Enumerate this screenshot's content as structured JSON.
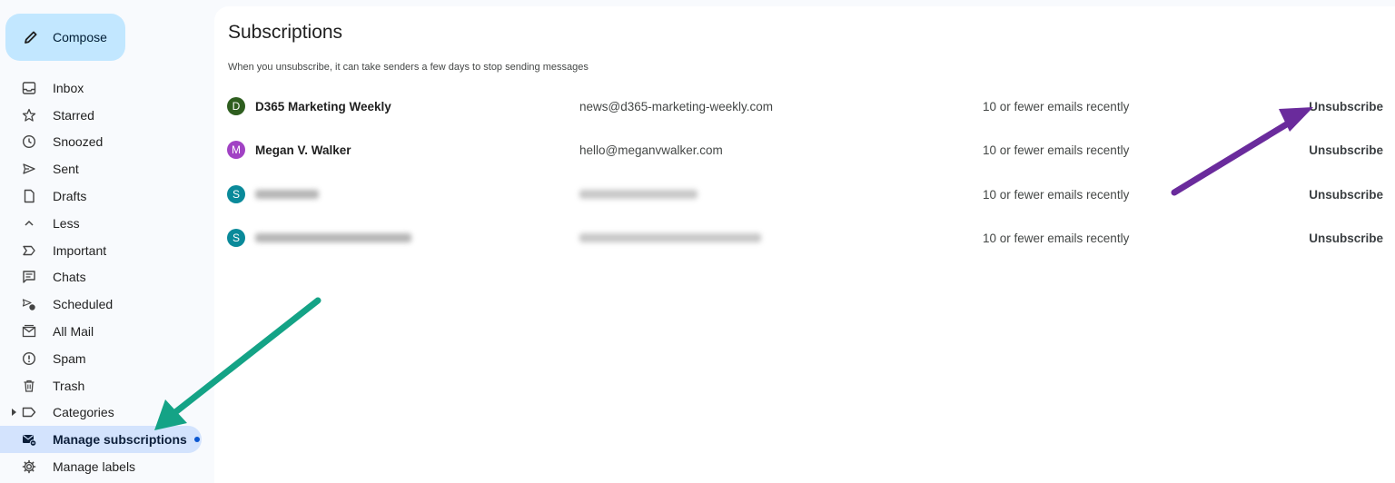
{
  "sidebar": {
    "compose_label": "Compose",
    "items": [
      {
        "label": "Inbox",
        "icon": "inbox-icon"
      },
      {
        "label": "Starred",
        "icon": "star-icon"
      },
      {
        "label": "Snoozed",
        "icon": "clock-icon"
      },
      {
        "label": "Sent",
        "icon": "send-icon"
      },
      {
        "label": "Drafts",
        "icon": "draft-icon"
      },
      {
        "label": "Less",
        "icon": "chevron-up-icon"
      },
      {
        "label": "Important",
        "icon": "important-icon"
      },
      {
        "label": "Chats",
        "icon": "chat-icon"
      },
      {
        "label": "Scheduled",
        "icon": "schedule-send-icon"
      },
      {
        "label": "All Mail",
        "icon": "all-mail-icon"
      },
      {
        "label": "Spam",
        "icon": "spam-icon"
      },
      {
        "label": "Trash",
        "icon": "trash-icon"
      },
      {
        "label": "Categories",
        "icon": "label-icon"
      },
      {
        "label": "Manage subscriptions",
        "icon": "subscriptions-icon",
        "active": true
      },
      {
        "label": "Manage labels",
        "icon": "gear-icon"
      }
    ]
  },
  "main": {
    "title": "Subscriptions",
    "subtitle": "When you unsubscribe, it can take senders a few days to stop sending messages",
    "rows": [
      {
        "initial": "D",
        "color": "#2e5e1f",
        "sender": "D365 Marketing Weekly",
        "email": "news@d365-marketing-weekly.com",
        "frequency": "10 or fewer emails recently",
        "action": "Unsubscribe"
      },
      {
        "initial": "M",
        "color": "#a142c4",
        "sender": "Megan V. Walker",
        "email": "hello@meganvwalker.com",
        "frequency": "10 or fewer emails recently",
        "action": "Unsubscribe"
      },
      {
        "initial": "S",
        "color": "#0a8a9a",
        "sender": "",
        "email": "",
        "frequency": "10 or fewer emails recently",
        "action": "Unsubscribe"
      },
      {
        "initial": "S",
        "color": "#0a8a9a",
        "sender": "",
        "email": "",
        "frequency": "10 or fewer emails recently",
        "action": "Unsubscribe"
      }
    ]
  },
  "colors": {
    "active_bg": "#d3e3fd",
    "compose_bg": "#c2e7ff",
    "arrow_green": "#14a386",
    "arrow_purple": "#6a2b9c"
  }
}
